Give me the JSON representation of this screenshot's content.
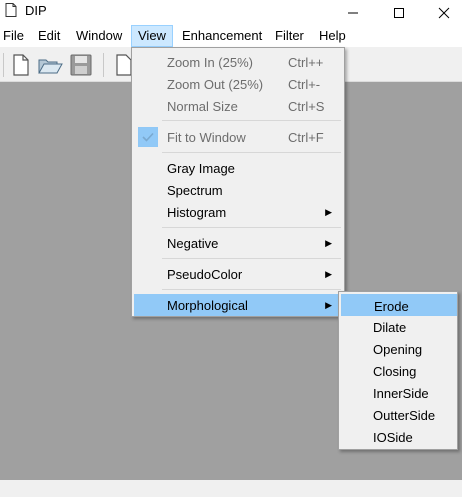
{
  "window": {
    "title": "DIP"
  },
  "menubar": [
    "File",
    "Edit",
    "Window",
    "View",
    "Enhancement",
    "Filter",
    "Help"
  ],
  "view_menu": {
    "items": [
      {
        "label": "Zoom In (25%)",
        "shortcut": "Ctrl++",
        "disabled": true
      },
      {
        "label": "Zoom Out (25%)",
        "shortcut": "Ctrl+-",
        "disabled": true
      },
      {
        "label": "Normal Size",
        "shortcut": "Ctrl+S",
        "disabled": true
      },
      {
        "label": "Fit to Window",
        "shortcut": "Ctrl+F",
        "disabled": true,
        "checked": true
      },
      {
        "label": "Gray Image"
      },
      {
        "label": "Spectrum"
      },
      {
        "label": "Histogram",
        "submenu": true
      },
      {
        "label": "Negative",
        "submenu": true
      },
      {
        "label": "PseudoColor",
        "submenu": true
      },
      {
        "label": "Morphological",
        "submenu": true,
        "highlighted": true
      }
    ]
  },
  "morphological_menu": {
    "items": [
      "Erode",
      "Dilate",
      "Opening",
      "Closing",
      "InnerSide",
      "OutterSide",
      "IOSide"
    ]
  },
  "colors": {
    "highlight": "#91c9f7",
    "workspace": "#a0a0a0",
    "menu_bg": "#f0f0f0",
    "active_menu": "#cce8ff"
  },
  "icons": [
    "new-file-icon",
    "open-folder-icon",
    "save-icon",
    "page-icon"
  ]
}
